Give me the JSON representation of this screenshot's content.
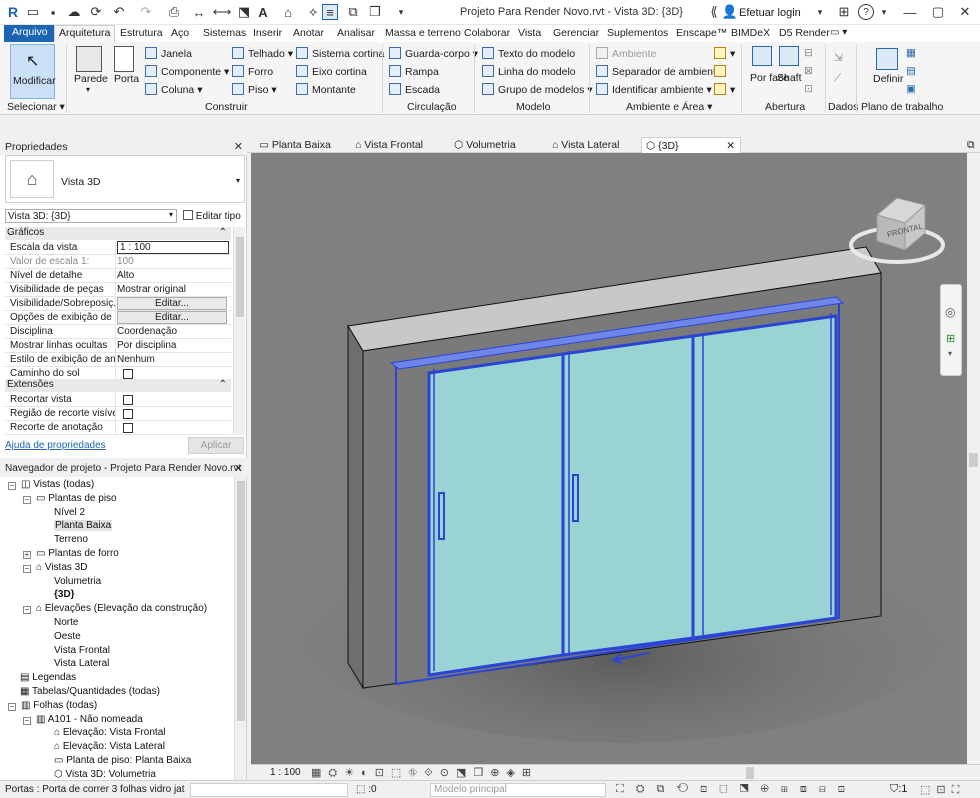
{
  "app": {
    "title": "Projeto Para Render Novo.rvt - Vista 3D: {3D}",
    "login_label": "Efetuar login",
    "help_label": "?"
  },
  "menu_tabs": [
    "Arquivo",
    "Arquitetura",
    "Estrutura",
    "Aço",
    "Sistemas",
    "Inserir",
    "Anotar",
    "Analisar",
    "Massa e terreno",
    "Colaborar",
    "Vista",
    "Gerenciar",
    "Suplementos",
    "Enscape™",
    "BIMDeX",
    "D5 Render"
  ],
  "ribbon": {
    "modificar": "Modificar",
    "selecionar": "Selecionar",
    "construir": {
      "label": "Construir",
      "parede": "Parede",
      "porta": "Porta",
      "items": [
        "Janela",
        "Componente",
        "Coluna",
        "Telhado",
        "Forro",
        "Piso",
        "Sistema cortina",
        "Eixo cortina",
        "Montante"
      ]
    },
    "circulacao": {
      "label": "Circulação",
      "items": [
        "Guarda-corpo",
        "Rampa",
        "Escada"
      ]
    },
    "modelo": {
      "label": "Modelo",
      "items": [
        "Texto do modelo",
        "Linha do modelo",
        "Grupo de modelos"
      ]
    },
    "ambiente_area": {
      "label": "Ambiente e Área",
      "items": [
        "Ambiente",
        "Separador de ambiente",
        "Identificar ambiente"
      ]
    },
    "abertura": {
      "label": "Abertura",
      "por_face": "Por face",
      "shaft": "Shaft"
    },
    "dados": {
      "label": "Dados"
    },
    "plano": {
      "label": "Plano de trabalho",
      "definir": "Definir"
    }
  },
  "properties": {
    "title": "Propriedades",
    "type_name": "Vista 3D",
    "instance_selector": "Vista 3D: {3D}",
    "edit_type": "Editar tipo",
    "graficos_label": "Gráficos",
    "rows": [
      {
        "name": "Escala da vista",
        "value": "1 : 100"
      },
      {
        "name": "Valor de escala    1:",
        "value": "100"
      },
      {
        "name": "Nível de detalhe",
        "value": "Alto"
      },
      {
        "name": "Visibilidade de peças",
        "value": "Mostrar original"
      },
      {
        "name": "Visibilidade/Sobreposiç...",
        "value": "Editar..."
      },
      {
        "name": "Opções de exibição de ...",
        "value": "Editar..."
      },
      {
        "name": "Disciplina",
        "value": "Coordenação"
      },
      {
        "name": "Mostrar linhas ocultas",
        "value": "Por disciplina"
      },
      {
        "name": "Estilo de exibição de an...",
        "value": "Nenhum"
      },
      {
        "name": "Caminho do sol",
        "value": ""
      }
    ],
    "extensoes_label": "Extensões",
    "ext_rows": [
      {
        "name": "Recortar vista"
      },
      {
        "name": "Região de recorte visível"
      },
      {
        "name": "Recorte de anotação"
      }
    ],
    "help_link": "Ajuda de propriedades",
    "apply": "Aplicar"
  },
  "browser": {
    "title": "Navegador de projeto - Projeto Para Render Novo.rvt",
    "nodes": [
      {
        "label": "Vistas (todas)",
        "level": 0,
        "expander": "−",
        "bold": false
      },
      {
        "label": "Plantas de piso",
        "level": 1,
        "expander": "−",
        "bold": false
      },
      {
        "label": "Nível 2",
        "level": 2,
        "expander": "",
        "bold": false
      },
      {
        "label": "Planta Baixa",
        "level": 2,
        "expander": "",
        "bold": false,
        "selected": true
      },
      {
        "label": "Terreno",
        "level": 2,
        "expander": "",
        "bold": false
      },
      {
        "label": "Plantas de forro",
        "level": 1,
        "expander": "+",
        "bold": false
      },
      {
        "label": "Vistas 3D",
        "level": 1,
        "expander": "−",
        "bold": false
      },
      {
        "label": "Volumetria",
        "level": 2,
        "expander": "",
        "bold": false
      },
      {
        "label": "{3D}",
        "level": 2,
        "expander": "",
        "bold": true
      },
      {
        "label": "Elevações (Elevação da construção)",
        "level": 1,
        "expander": "−",
        "bold": false
      },
      {
        "label": "Norte",
        "level": 2,
        "expander": "",
        "bold": false
      },
      {
        "label": "Oeste",
        "level": 2,
        "expander": "",
        "bold": false
      },
      {
        "label": "Vista Frontal",
        "level": 2,
        "expander": "",
        "bold": false
      },
      {
        "label": "Vista Lateral",
        "level": 2,
        "expander": "",
        "bold": false
      },
      {
        "label": "Legendas",
        "level": 0,
        "expander": "",
        "bold": false
      },
      {
        "label": "Tabelas/Quantidades (todas)",
        "level": 0,
        "expander": "",
        "bold": false
      },
      {
        "label": "Folhas (todas)",
        "level": 0,
        "expander": "−",
        "bold": false
      },
      {
        "label": "A101 - Não nomeada",
        "level": 1,
        "expander": "−",
        "bold": false
      },
      {
        "label": "Elevação: Vista Frontal",
        "level": 2,
        "expander": "",
        "bold": false
      },
      {
        "label": "Elevação: Vista Lateral",
        "level": 2,
        "expander": "",
        "bold": false
      },
      {
        "label": "Planta de piso: Planta Baixa",
        "level": 2,
        "expander": "",
        "bold": false
      },
      {
        "label": "Vista 3D: Volumetria",
        "level": 2,
        "expander": "",
        "bold": false
      }
    ]
  },
  "view_tabs": [
    "Planta Baixa",
    "Vista Frontal",
    "Volumetria",
    "Vista Lateral",
    "{3D}"
  ],
  "viewcube": {
    "face_label": "FRONTAL"
  },
  "view_control": {
    "scale": "1 : 100"
  },
  "status": {
    "selection": "Portas : Porta de correr 3 folhas vidro jat",
    "count": ":0",
    "model": "Modelo principal",
    "filter_count": ":1"
  }
}
